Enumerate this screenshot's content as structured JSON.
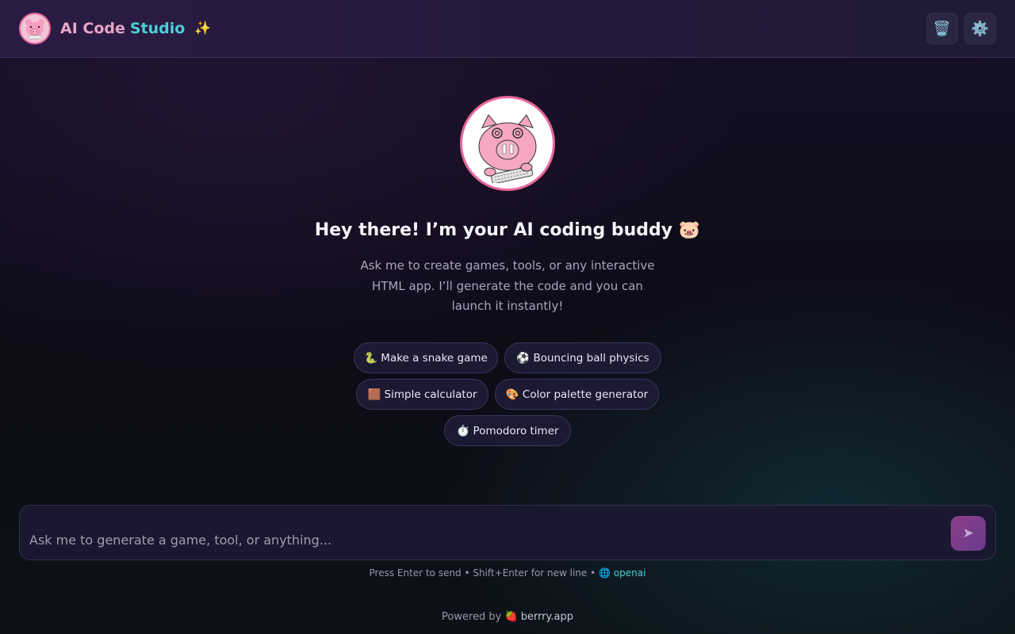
{
  "header": {
    "brand_part1": "AI Code",
    "brand_part2": "Studio",
    "sparkle": "✨",
    "actions": [
      {
        "name": "trash-icon",
        "glyph": "🗑️"
      },
      {
        "name": "gear-icon",
        "glyph": "⚙️"
      }
    ]
  },
  "hero": {
    "title": "Hey there! I’m your AI coding buddy 🐷",
    "subtitle_line1": "Ask me to create games, tools, or any interactive",
    "subtitle_line2": "HTML app. I’ll generate the code and you can",
    "subtitle_line3": "launch it instantly!"
  },
  "suggestions": [
    {
      "icon": "🐍",
      "label": "Make a snake game"
    },
    {
      "icon": "⚽",
      "label": "Bouncing ball physics"
    },
    {
      "icon": "🟫",
      "label": "Simple calculator"
    },
    {
      "icon": "🎨",
      "label": "Color palette generator"
    },
    {
      "icon": "⏱️",
      "label": "Pomodoro timer"
    }
  ],
  "composer": {
    "placeholder": "Ask me to generate a game, tool, or anything...",
    "value": "",
    "send_glyph": "➤"
  },
  "hint": {
    "text": "Press Enter to send • Shift+Enter for new line •",
    "provider_icon": "🌐",
    "provider": "openai"
  },
  "footer": {
    "powered_by": "Powered by",
    "berry_icon": "🍓",
    "site": "berrry.app"
  },
  "colors": {
    "accent_pink": "#e8659a",
    "accent_cyan": "#4dd0d6",
    "send_button": "#8a3f86"
  }
}
